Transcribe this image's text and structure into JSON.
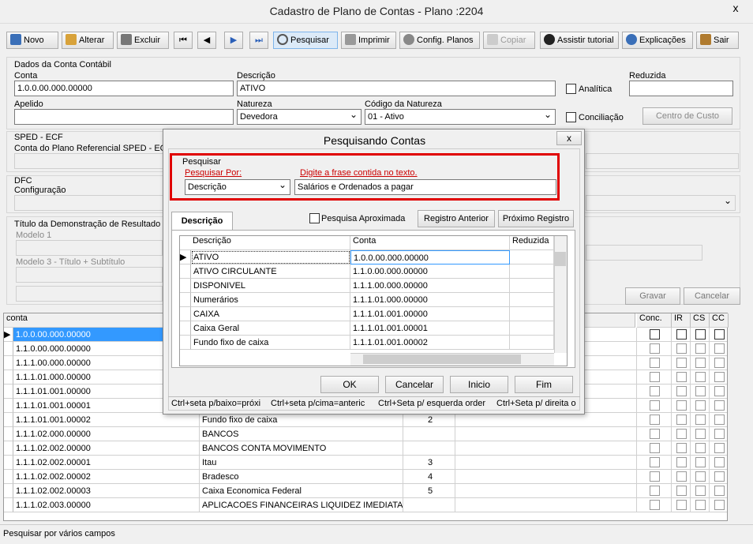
{
  "window": {
    "title": "Cadastro de Plano de Contas - Plano :2204",
    "close": "x"
  },
  "toolbar": [
    "Novo",
    "Alterar",
    "Excluir",
    "Pesquisar",
    "Imprimir",
    "Config. Planos",
    "Copiar",
    "Assistir tutorial",
    "Explicações",
    "Sair"
  ],
  "form": {
    "section_title": "Dados da Conta Contábil",
    "conta_label": "Conta",
    "conta_value": "1.0.0.00.000.00000",
    "descricao_label": "Descrição",
    "descricao_value": "ATIVO",
    "analitica_label": "Analítica",
    "reduzida_label": "Reduzida",
    "apelido_label": "Apelido",
    "natureza_label": "Natureza",
    "natureza_value": "Devedora",
    "codnat_label": "Código da Natureza",
    "codnat_value": "01 - Ativo",
    "conciliacao_label": "Conciliação",
    "centro_label": "Centro de Custo",
    "sped_label": "SPED - ECF",
    "ref_label": "Conta do Plano Referencial SPED - ECF",
    "dfc_label": "DFC",
    "config_label": "Configuração",
    "titulo_label": "Título da Demonstração de Resultado",
    "modelo1_label": "Modelo 1",
    "modelo3_label": "Modelo 3 - Título + Subtítulo",
    "gravar": "Gravar",
    "cancelar": "Cancelar"
  },
  "grid": {
    "headers": [
      "conta",
      "Conc.",
      "IR",
      "CS",
      "CC"
    ],
    "rows": [
      {
        "conta": "1.0.0.00.000.00000",
        "desc": "",
        "red": ""
      },
      {
        "conta": "1.1.0.00.000.00000",
        "desc": "",
        "red": ""
      },
      {
        "conta": "1.1.1.00.000.00000",
        "desc": "",
        "red": ""
      },
      {
        "conta": "1.1.1.01.000.00000",
        "desc": "",
        "red": ""
      },
      {
        "conta": "1.1.1.01.001.00000",
        "desc": "",
        "red": ""
      },
      {
        "conta": "1.1.1.01.001.00001",
        "desc": "",
        "red": ""
      },
      {
        "conta": "1.1.1.01.001.00002",
        "desc": "Fundo fixo de caixa",
        "red": "2"
      },
      {
        "conta": "1.1.1.02.000.00000",
        "desc": "BANCOS",
        "red": ""
      },
      {
        "conta": "1.1.1.02.002.00000",
        "desc": "BANCOS CONTA MOVIMENTO",
        "red": ""
      },
      {
        "conta": "1.1.1.02.002.00001",
        "desc": "Itau",
        "red": "3"
      },
      {
        "conta": "1.1.1.02.002.00002",
        "desc": "Bradesco",
        "red": "4"
      },
      {
        "conta": "1.1.1.02.002.00003",
        "desc": "Caixa Economica Federal",
        "red": "5"
      },
      {
        "conta": "1.1.1.02.003.00000",
        "desc": "APLICACOES FINANCEIRAS LIQUIDEZ IMEDIATA",
        "red": ""
      }
    ]
  },
  "dialog": {
    "title": "Pesquisando Contas",
    "close": "x",
    "group": "Pesquisar",
    "por_label": "Pesquisar Por:",
    "por_value": "Descrição",
    "frase_label": "Digite a frase contida no texto.",
    "frase_value": "Salários e Ordenados a pagar",
    "tab": "Descrição",
    "aprox": "Pesquisa Aproximada",
    "prev": "Registro Anterior",
    "next": "Próximo Registro",
    "headers": [
      "Descrição",
      "Conta",
      "Reduzida"
    ],
    "rows": [
      {
        "d": "ATIVO",
        "c": "1.0.0.00.000.00000"
      },
      {
        "d": "ATIVO CIRCULANTE",
        "c": "1.1.0.00.000.00000"
      },
      {
        "d": "DISPONIVEL",
        "c": "1.1.1.00.000.00000"
      },
      {
        "d": "Numerários",
        "c": "1.1.1.01.000.00000"
      },
      {
        "d": "CAIXA",
        "c": "1.1.1.01.001.00000"
      },
      {
        "d": "Caixa Geral",
        "c": "1.1.1.01.001.00001"
      },
      {
        "d": "Fundo fixo de caixa",
        "c": "1.1.1.01.001.00002"
      }
    ],
    "ok": "OK",
    "cancel": "Cancelar",
    "inicio": "Inicio",
    "fim": "Fim",
    "hints": [
      "Ctrl+seta p/baixo=próxi",
      "Ctrl+seta p/cima=anteric",
      "Ctrl+Seta p/ esquerda order",
      "Ctrl+Seta p/ direita o"
    ]
  },
  "status": "Pesquisar por vários campos"
}
